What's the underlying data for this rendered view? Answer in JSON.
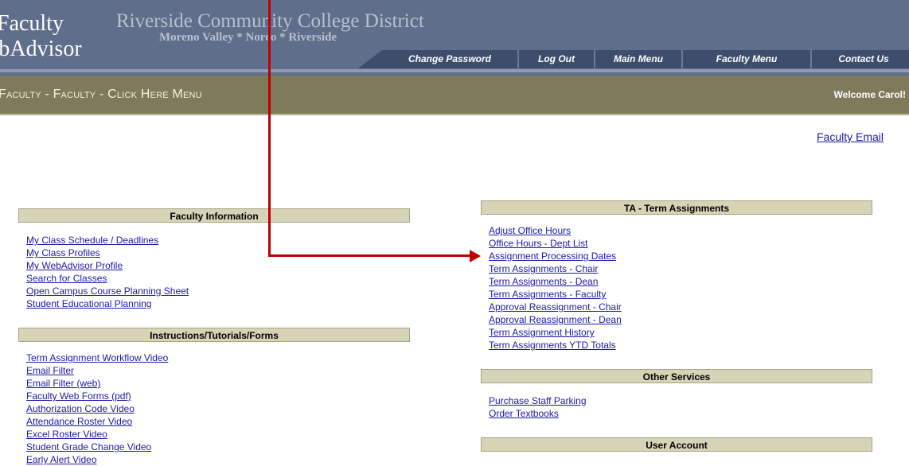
{
  "header": {
    "logo_line1": "Faculty",
    "logo_line2": "ebAdvisor",
    "district": "Riverside Community College District",
    "campuses": "Moreno Valley * Norco * Riverside",
    "nav": [
      "Change Password",
      "Log Out",
      "Main Menu",
      "Faculty Menu",
      "Contact Us"
    ]
  },
  "titlebar": {
    "title": "Faculty - Faculty - Click Here Menu",
    "welcome": "Welcome Carol!"
  },
  "faculty_email": "Faculty Email",
  "sections": {
    "faculty_info": {
      "heading": "Faculty Information",
      "links": [
        "My Class Schedule / Deadlines",
        "My Class Profiles",
        "My WebAdvisor Profile",
        "Search for Classes",
        "Open Campus Course Planning Sheet",
        "Student Educational Planning"
      ]
    },
    "instructions": {
      "heading": "Instructions/Tutorials/Forms",
      "links": [
        "Term Assignment Workflow Video",
        "Email Filter",
        "Email Filter (web)",
        "Faculty Web Forms (pdf)",
        "Authorization Code Video",
        "Attendance Roster Video",
        "Excel Roster Video",
        "Student Grade Change Video",
        "Early Alert Video"
      ]
    },
    "term_assignments": {
      "heading": "TA - Term Assignments",
      "links": [
        "Adjust Office Hours",
        "Office Hours - Dept List",
        "Assignment Processing Dates",
        "Term Assignments - Chair",
        "Term Assignments - Dean",
        "Term Assignments - Faculty",
        "Approval Reassignment - Chair",
        "Approval Reassignment - Dean",
        "Term Assignment History",
        "Term Assignments YTD Totals"
      ]
    },
    "other_services": {
      "heading": "Other Services",
      "links": [
        "Purchase Staff Parking",
        "Order Textbooks"
      ]
    },
    "user_account": {
      "heading": "User Account"
    }
  },
  "colors": {
    "header_bg": "#5f6e8a",
    "titlebar_bg": "#7f7a5a",
    "section_head_bg": "#d6d3b6",
    "link": "#1a1aa6",
    "arrow": "#c00000"
  }
}
